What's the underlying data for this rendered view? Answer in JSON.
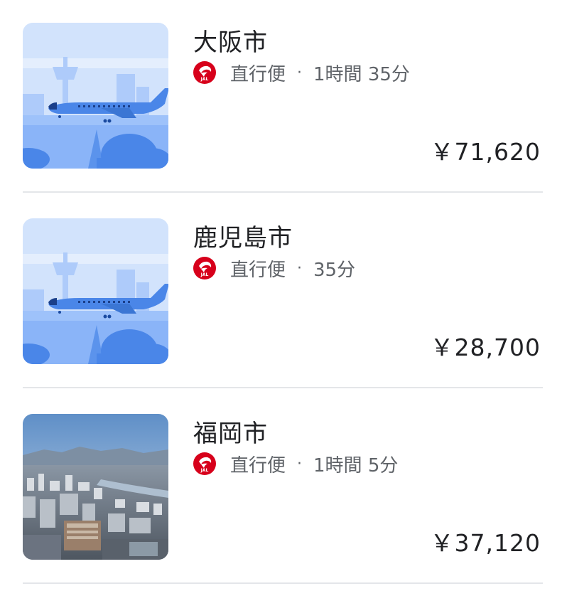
{
  "results": [
    {
      "city": "大阪市",
      "airline_icon": "jal-crane-logo",
      "flight_type": "直行便",
      "separator": "·",
      "duration": "1時間 35分",
      "price": "￥71,620",
      "image": "airport-illustration"
    },
    {
      "city": "鹿児島市",
      "airline_icon": "jal-crane-logo",
      "flight_type": "直行便",
      "separator": "·",
      "duration": "35分",
      "price": "￥28,700",
      "image": "airport-illustration"
    },
    {
      "city": "福岡市",
      "airline_icon": "jal-crane-logo",
      "flight_type": "直行便",
      "separator": "·",
      "duration": "1時間 5分",
      "price": "￥37,120",
      "image": "city-photo"
    }
  ],
  "colors": {
    "jal_red": "#d7001b",
    "text_primary": "#202124",
    "text_secondary": "#5f6368",
    "divider": "#e4e6e9"
  }
}
